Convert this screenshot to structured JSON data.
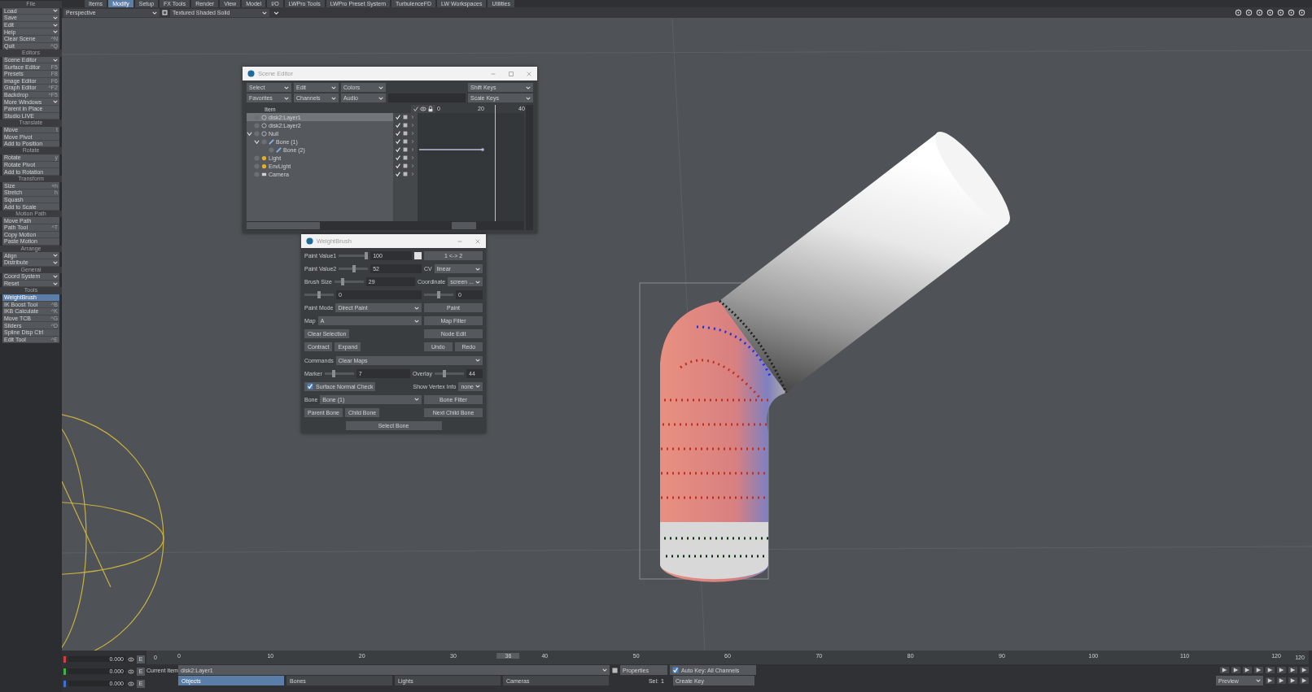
{
  "menu_tabs": [
    {
      "label": "Items",
      "selected": false
    },
    {
      "label": "Modify",
      "selected": true
    },
    {
      "label": "Setup",
      "selected": false
    },
    {
      "label": "FX Tools",
      "selected": false
    },
    {
      "label": "Render",
      "selected": false
    },
    {
      "label": "View",
      "selected": false
    },
    {
      "label": "Model",
      "selected": false
    },
    {
      "label": "I/O",
      "selected": false
    },
    {
      "label": "LWPro Tools",
      "selected": false
    },
    {
      "label": "LWPro Preset System",
      "selected": false
    },
    {
      "label": "TurbulenceFD",
      "selected": false
    },
    {
      "label": "LW Workspaces",
      "selected": false
    },
    {
      "label": "Utilities",
      "selected": false
    }
  ],
  "viewport_bar": {
    "view": "Perspective",
    "shading": "Textured Shaded Solid"
  },
  "sidebar": [
    {
      "header": "File",
      "items": [
        {
          "label": "Load",
          "kind": "menu",
          "selected": false
        },
        {
          "label": "Save",
          "kind": "menu",
          "selected": false
        },
        {
          "label": "Edit",
          "kind": "menu",
          "selected": false
        },
        {
          "label": "Help",
          "kind": "menu",
          "selected": false
        },
        {
          "label": "Clear Scene",
          "kind": "button",
          "shortcut": "^N",
          "selected": false
        },
        {
          "label": "Quit",
          "kind": "button",
          "shortcut": "^Q",
          "selected": false
        }
      ]
    },
    {
      "header": "Editors",
      "items": [
        {
          "label": "Scene Editor",
          "kind": "menu",
          "selected": false
        },
        {
          "label": "Surface Editor",
          "kind": "button",
          "shortcut": "F5",
          "selected": false
        },
        {
          "label": "Presets",
          "kind": "button",
          "shortcut": "F8",
          "selected": false
        },
        {
          "label": "Image Editor",
          "kind": "button",
          "shortcut": "F6",
          "selected": false
        },
        {
          "label": "Graph Editor",
          "kind": "button",
          "shortcut": "^F2",
          "selected": false
        },
        {
          "label": "Backdrop",
          "kind": "button",
          "shortcut": "^F5",
          "selected": false
        },
        {
          "label": "More Windows",
          "kind": "menu",
          "selected": false
        },
        {
          "label": "Parent in Place",
          "kind": "button",
          "selected": false
        },
        {
          "label": "Studio LIVE",
          "kind": "button",
          "selected": false
        }
      ]
    },
    {
      "header": "Translate",
      "items": [
        {
          "label": "Move",
          "kind": "button",
          "shortcut": "t",
          "selected": false
        },
        {
          "label": "Move Pivot",
          "kind": "button",
          "selected": false
        },
        {
          "label": "Add to Position",
          "kind": "button",
          "selected": false
        }
      ]
    },
    {
      "header": "Rotate",
      "items": [
        {
          "label": "Rotate",
          "kind": "button",
          "shortcut": "y",
          "selected": false
        },
        {
          "label": "Rotate Pivot",
          "kind": "button",
          "selected": false
        },
        {
          "label": "Add to Rotation",
          "kind": "button",
          "selected": false
        }
      ]
    },
    {
      "header": "Transform",
      "items": [
        {
          "label": "Size",
          "kind": "button",
          "shortcut": "+h",
          "selected": false
        },
        {
          "label": "Stretch",
          "kind": "button",
          "shortcut": "h",
          "selected": false
        },
        {
          "label": "Squash",
          "kind": "button",
          "selected": false
        },
        {
          "label": "Add to Scale",
          "kind": "button",
          "selected": false
        }
      ]
    },
    {
      "header": "Motion Path",
      "items": [
        {
          "label": "Move Path",
          "kind": "button",
          "selected": false
        },
        {
          "label": "Path Tool",
          "kind": "button",
          "shortcut": "^T",
          "selected": false
        },
        {
          "label": "Copy Motion",
          "kind": "button",
          "selected": false
        },
        {
          "label": "Paste Motion",
          "kind": "button",
          "selected": false
        }
      ]
    },
    {
      "header": "Arrange",
      "items": [
        {
          "label": "Align",
          "kind": "menu",
          "selected": false
        },
        {
          "label": "Distribute",
          "kind": "menu",
          "selected": false
        }
      ]
    },
    {
      "header": "General",
      "items": [
        {
          "label": "Coord System",
          "kind": "menu",
          "selected": false
        },
        {
          "label": "Reset",
          "kind": "menu",
          "selected": false
        }
      ]
    },
    {
      "header": "Tools",
      "items": [
        {
          "label": "WeightBrush",
          "kind": "button",
          "selected": true
        },
        {
          "label": "IK Boost Tool",
          "kind": "button",
          "shortcut": "^B",
          "selected": false
        },
        {
          "label": "IKB Calculate",
          "kind": "button",
          "shortcut": "^K",
          "selected": false
        },
        {
          "label": "Move TCB",
          "kind": "button",
          "shortcut": "^G",
          "selected": false
        },
        {
          "label": "Sliders",
          "kind": "button",
          "shortcut": "^D",
          "selected": false
        },
        {
          "label": "Spline Disp Ctrl",
          "kind": "button",
          "selected": false
        },
        {
          "label": "Edit Tool",
          "kind": "button",
          "shortcut": "^E",
          "selected": false
        }
      ]
    }
  ],
  "scene_editor": {
    "title": "Scene Editor",
    "menus": [
      [
        "Select",
        "Edit",
        "Colors"
      ],
      [
        "Favorites",
        "Channels",
        "Audio"
      ]
    ],
    "key_menus": [
      "Shift Keys",
      "Scale Keys"
    ],
    "item_header": "Item",
    "ticks": [
      "0",
      "20",
      "40"
    ],
    "items": [
      {
        "name": "disk2:Layer1",
        "kind": "mesh",
        "selected": true,
        "active": true,
        "has_keys": false
      },
      {
        "name": "disk2:Layer2",
        "kind": "mesh",
        "selected": false,
        "active": true,
        "has_keys": false
      },
      {
        "name": "Null",
        "kind": "null",
        "selected": false,
        "active": true,
        "has_keys": false,
        "expanded": true,
        "children": [
          {
            "name": "Bone (1)",
            "kind": "bone",
            "selected": false,
            "active": true,
            "has_keys": false,
            "expanded": true,
            "children": [
              {
                "name": "Bone (2)",
                "kind": "bone",
                "selected": false,
                "active": true,
                "has_keys": true
              }
            ]
          }
        ]
      },
      {
        "name": "Light",
        "kind": "light",
        "selected": false,
        "active": true,
        "has_keys": false
      },
      {
        "name": "EnvLight",
        "kind": "light",
        "selected": false,
        "active": true,
        "has_keys": false
      },
      {
        "name": "Camera",
        "kind": "camera",
        "selected": false,
        "active": true,
        "has_keys": false
      }
    ]
  },
  "weightbrush": {
    "title": "WeightBrush",
    "rows": [
      {
        "left": [
          {
            "kind": "label",
            "text": "Paint Value1"
          },
          {
            "kind": "slider",
            "level": 1.0
          },
          {
            "kind": "field",
            "value": "100"
          },
          {
            "kind": "swatch",
            "color": "#e0e0e0"
          }
        ],
        "right": [
          {
            "kind": "button",
            "text": "1 <-> 2"
          }
        ]
      },
      {
        "left": [
          {
            "kind": "label",
            "text": "Paint Value2"
          },
          {
            "kind": "slider",
            "level": 0.52
          },
          {
            "kind": "field",
            "value": "52"
          }
        ],
        "right": [
          {
            "kind": "label",
            "text": "CV"
          },
          {
            "kind": "dropdown",
            "text": "linear"
          }
        ]
      },
      {
        "left": [
          {
            "kind": "label",
            "text": "Brush Size"
          },
          {
            "kind": "slider",
            "level": 0.25
          },
          {
            "kind": "field",
            "value": "29"
          }
        ],
        "right": [
          {
            "kind": "label",
            "text": "Coordinate"
          },
          {
            "kind": "dropdown",
            "text": "screen ..."
          }
        ]
      },
      {
        "left": [
          {
            "kind": "slider",
            "level": 0.5
          },
          {
            "kind": "field",
            "value": "0"
          }
        ],
        "right": [
          {
            "kind": "slider",
            "level": 0.5
          },
          {
            "kind": "field",
            "value": "0"
          }
        ]
      },
      {
        "left": [
          {
            "kind": "label",
            "text": "Paint Mode"
          },
          {
            "kind": "dropdown",
            "text": "Direct Paint"
          }
        ],
        "right": [
          {
            "kind": "button",
            "text": "Paint"
          }
        ]
      },
      {
        "left": [
          {
            "kind": "label",
            "text": "Map"
          },
          {
            "kind": "dropdown",
            "text": "A"
          }
        ],
        "right": [
          {
            "kind": "button",
            "text": "Map Filter"
          }
        ]
      },
      {
        "left": [
          {
            "kind": "button",
            "text": "Clear Selection"
          }
        ],
        "right": [
          {
            "kind": "button",
            "text": "Node Edit"
          }
        ]
      },
      {
        "left": [
          {
            "kind": "button",
            "text": "Contract"
          },
          {
            "kind": "button",
            "text": "Expand"
          }
        ],
        "right": [
          {
            "kind": "button",
            "text": "Undo"
          },
          {
            "kind": "button",
            "text": "Redo"
          }
        ]
      },
      {
        "left": [
          {
            "kind": "label",
            "text": "Commands"
          },
          {
            "kind": "dropdown",
            "text": "Clear Maps"
          }
        ]
      },
      {
        "left": [
          {
            "kind": "label",
            "text": "Marker"
          },
          {
            "kind": "slider",
            "level": 0.3
          },
          {
            "kind": "field",
            "value": "7"
          }
        ],
        "right": [
          {
            "kind": "label",
            "text": "Overlay"
          },
          {
            "kind": "slider",
            "level": 0.3
          },
          {
            "kind": "field",
            "value": "44"
          }
        ]
      },
      {
        "left": [
          {
            "kind": "checkbox",
            "text": "Surface Normal Check",
            "checked": true
          }
        ],
        "right": [
          {
            "kind": "label",
            "text": "Show Vertex Info"
          },
          {
            "kind": "dropdown",
            "text": "none"
          }
        ]
      },
      {
        "left": [
          {
            "kind": "label",
            "text": "Bone"
          },
          {
            "kind": "dropdown",
            "text": "Bone (1)"
          }
        ],
        "right": [
          {
            "kind": "button",
            "text": "Bone Filter"
          }
        ]
      },
      {
        "left": [
          {
            "kind": "button",
            "text": "Parent Bone"
          },
          {
            "kind": "button",
            "text": "Child Bone"
          }
        ],
        "right": [
          {
            "kind": "button",
            "text": "Next Child Bone"
          }
        ]
      },
      {
        "center": [
          {
            "kind": "button",
            "text": "Select Bone"
          }
        ]
      }
    ]
  },
  "timeline": {
    "start": "0",
    "end": "120",
    "current": "36",
    "level": 0.3,
    "ticks": [
      "0",
      "10",
      "20",
      "30",
      "40",
      "50",
      "60",
      "70",
      "80",
      "90",
      "100",
      "110",
      "120"
    ]
  },
  "bottom": {
    "channels": [
      {
        "value": "0.000",
        "color": "#d04040",
        "button": "E"
      },
      {
        "value": "0.000",
        "color": "#40b040",
        "button": "E"
      },
      {
        "value": "0.000",
        "color": "#4070d0",
        "button": "E"
      }
    ],
    "current_item_label": "Current Item",
    "current_item": "disk2:Layer1",
    "properties": "Properties",
    "auto_key": {
      "label": "Auto Key: All Channels",
      "checked": true
    },
    "item_tabs": [
      {
        "label": "Objects",
        "selected": true
      },
      {
        "label": "Bones",
        "selected": false
      },
      {
        "label": "Lights",
        "selected": false
      },
      {
        "label": "Cameras",
        "selected": false
      }
    ],
    "sel_label": "Sel:",
    "sel_value": "1",
    "create_key": "Create Key",
    "preview": "Preview"
  }
}
